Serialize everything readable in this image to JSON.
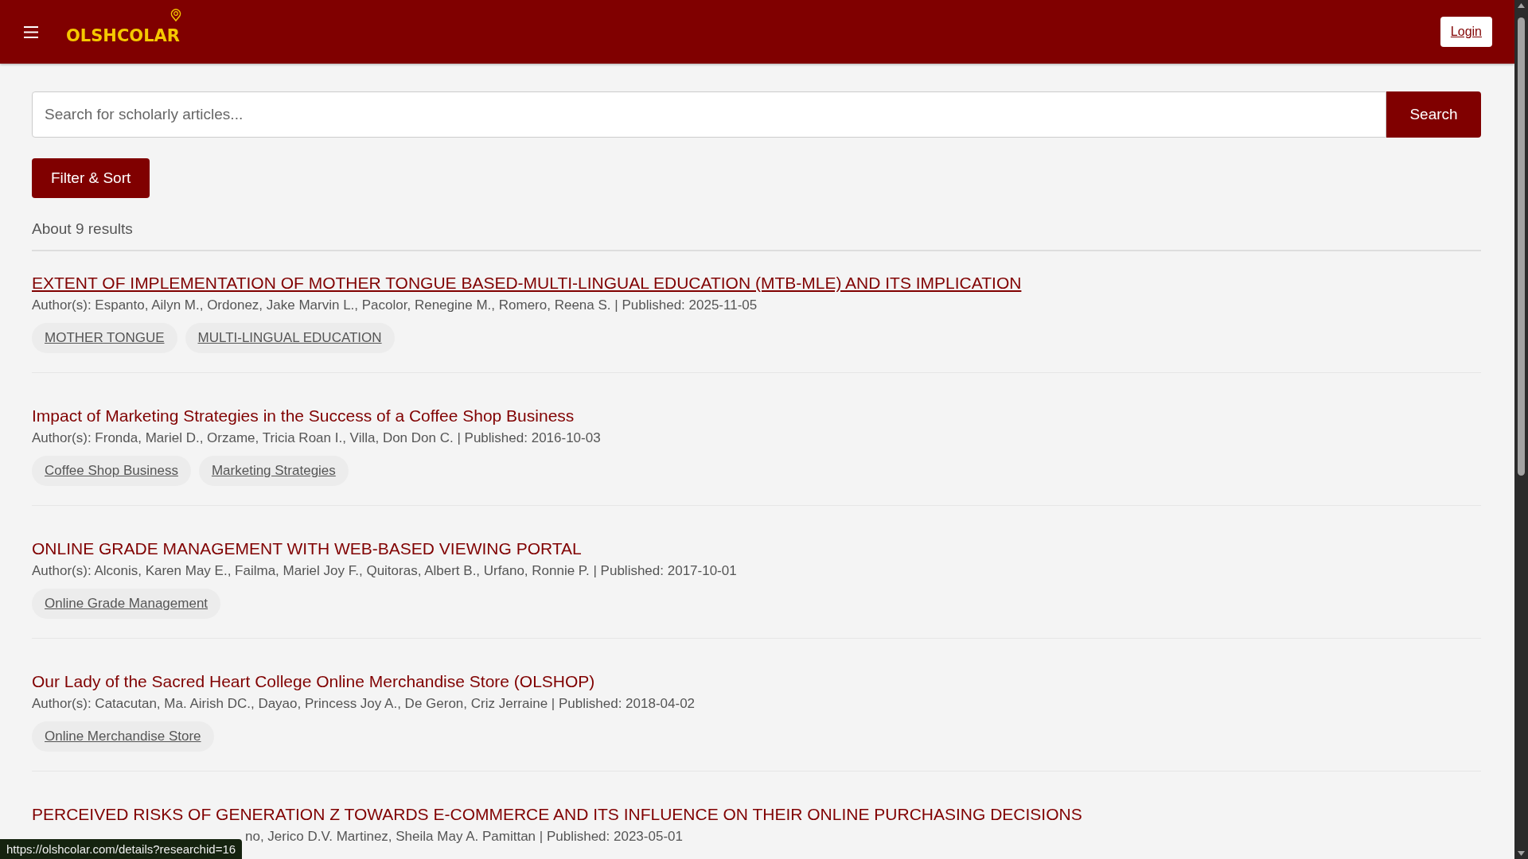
{
  "header": {
    "logo": "OLSHCOLAR",
    "login": "Login"
  },
  "search": {
    "placeholder": "Search for scholarly articles...",
    "button": "Search"
  },
  "filter_button": "Filter & Sort",
  "result_count": "About 9 results",
  "results": [
    {
      "title": "EXTENT OF IMPLEMENTATION OF MOTHER TONGUE BASED-MULTI-LINGUAL EDUCATION (MTB-MLE) AND ITS IMPLICATION",
      "hovered": true,
      "covered": false,
      "meta": "Author(s): Espanto, Ailyn M., Ordonez, Jake Marvin L., Pacolor, Renegine M., Romero, Reena S. | Published: 2025-11-05",
      "tags": [
        "MOTHER TONGUE",
        "MULTI-LINGUAL EDUCATION"
      ]
    },
    {
      "title": "Impact of Marketing Strategies in the Success of a Coffee Shop Business",
      "hovered": false,
      "covered": false,
      "meta": "Author(s): Fronda, Mariel D., Orzame, Tricia Roan I., Villa, Don Don C. | Published: 2016-10-03",
      "tags": [
        "Coffee Shop Business",
        "Marketing Strategies"
      ]
    },
    {
      "title": "ONLINE GRADE MANAGEMENT WITH WEB-BASED VIEWING PORTAL",
      "hovered": false,
      "covered": false,
      "meta": "Author(s): Alconis, Karen May E., Failma, Mariel Joy F., Quitoras, Albert B., Urfano, Ronnie P. | Published: 2017-10-01",
      "tags": [
        "Online Grade Management"
      ]
    },
    {
      "title": "Our Lady of the Sacred Heart College Online Merchandise Store (OLSHOP)",
      "hovered": false,
      "covered": false,
      "meta": "Author(s): Catacutan, Ma. Airish DC., Dayao, Princess Joy A., De Geron, Criz Jerraine | Published: 2018-04-02",
      "tags": [
        "Online Merchandise Store"
      ]
    },
    {
      "title": "PERCEIVED RISKS OF GENERATION Z TOWARDS E-COMMERCE AND ITS INFLUENCE ON THEIR ONLINE PURCHASING DECISIONS",
      "hovered": false,
      "covered": true,
      "meta": "no, Jerico D.V. Martinez, Sheila May A. Pamittan | Published: 2023-05-01"
    }
  ],
  "status_url": "https://olshcolar.com/details?researchid=16"
}
